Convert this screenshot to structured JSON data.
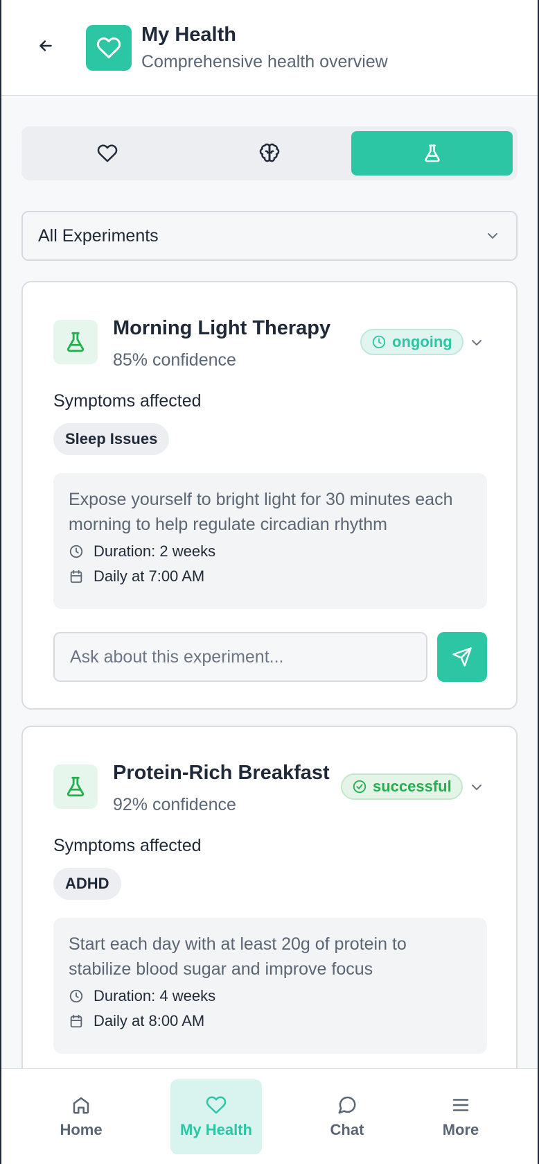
{
  "header": {
    "title": "My Health",
    "subtitle": "Comprehensive health overview",
    "back_icon": "arrow-left-icon",
    "logo_icon": "heart-icon",
    "brand_color": "#2cc6a5"
  },
  "tabs": [
    {
      "icon": "heart-icon",
      "active": false
    },
    {
      "icon": "brain-icon",
      "active": false
    },
    {
      "icon": "flask-icon",
      "active": true
    }
  ],
  "filter": {
    "selected": "All Experiments"
  },
  "experiments": [
    {
      "title": "Morning Light Therapy",
      "confidence": "85% confidence",
      "status": "ongoing",
      "status_icon": "clock-icon",
      "symptoms_label": "Symptoms affected",
      "symptoms": [
        "Sleep Issues"
      ],
      "description": "Expose yourself to bright light for 30 minutes each morning to help regulate circadian rhythm",
      "duration": "Duration: 2 weeks",
      "schedule": "Daily at 7:00 AM",
      "ask_placeholder": "Ask about this experiment..."
    },
    {
      "title": "Protein-Rich Breakfast",
      "confidence": "92% confidence",
      "status": "successful",
      "status_icon": "check-circle-icon",
      "symptoms_label": "Symptoms affected",
      "symptoms": [
        "ADHD"
      ],
      "description": "Start each day with at least 20g of protein to stabilize blood sugar and improve focus",
      "duration": "Duration: 4 weeks",
      "schedule": "Daily at 8:00 AM"
    }
  ],
  "bottom_nav": [
    {
      "label": "Home",
      "icon": "home-icon",
      "active": false
    },
    {
      "label": "My Health",
      "icon": "heart-icon",
      "active": true
    },
    {
      "label": "Chat",
      "icon": "chat-bubble-icon",
      "active": false
    },
    {
      "label": "More",
      "icon": "menu-icon",
      "active": false
    }
  ]
}
